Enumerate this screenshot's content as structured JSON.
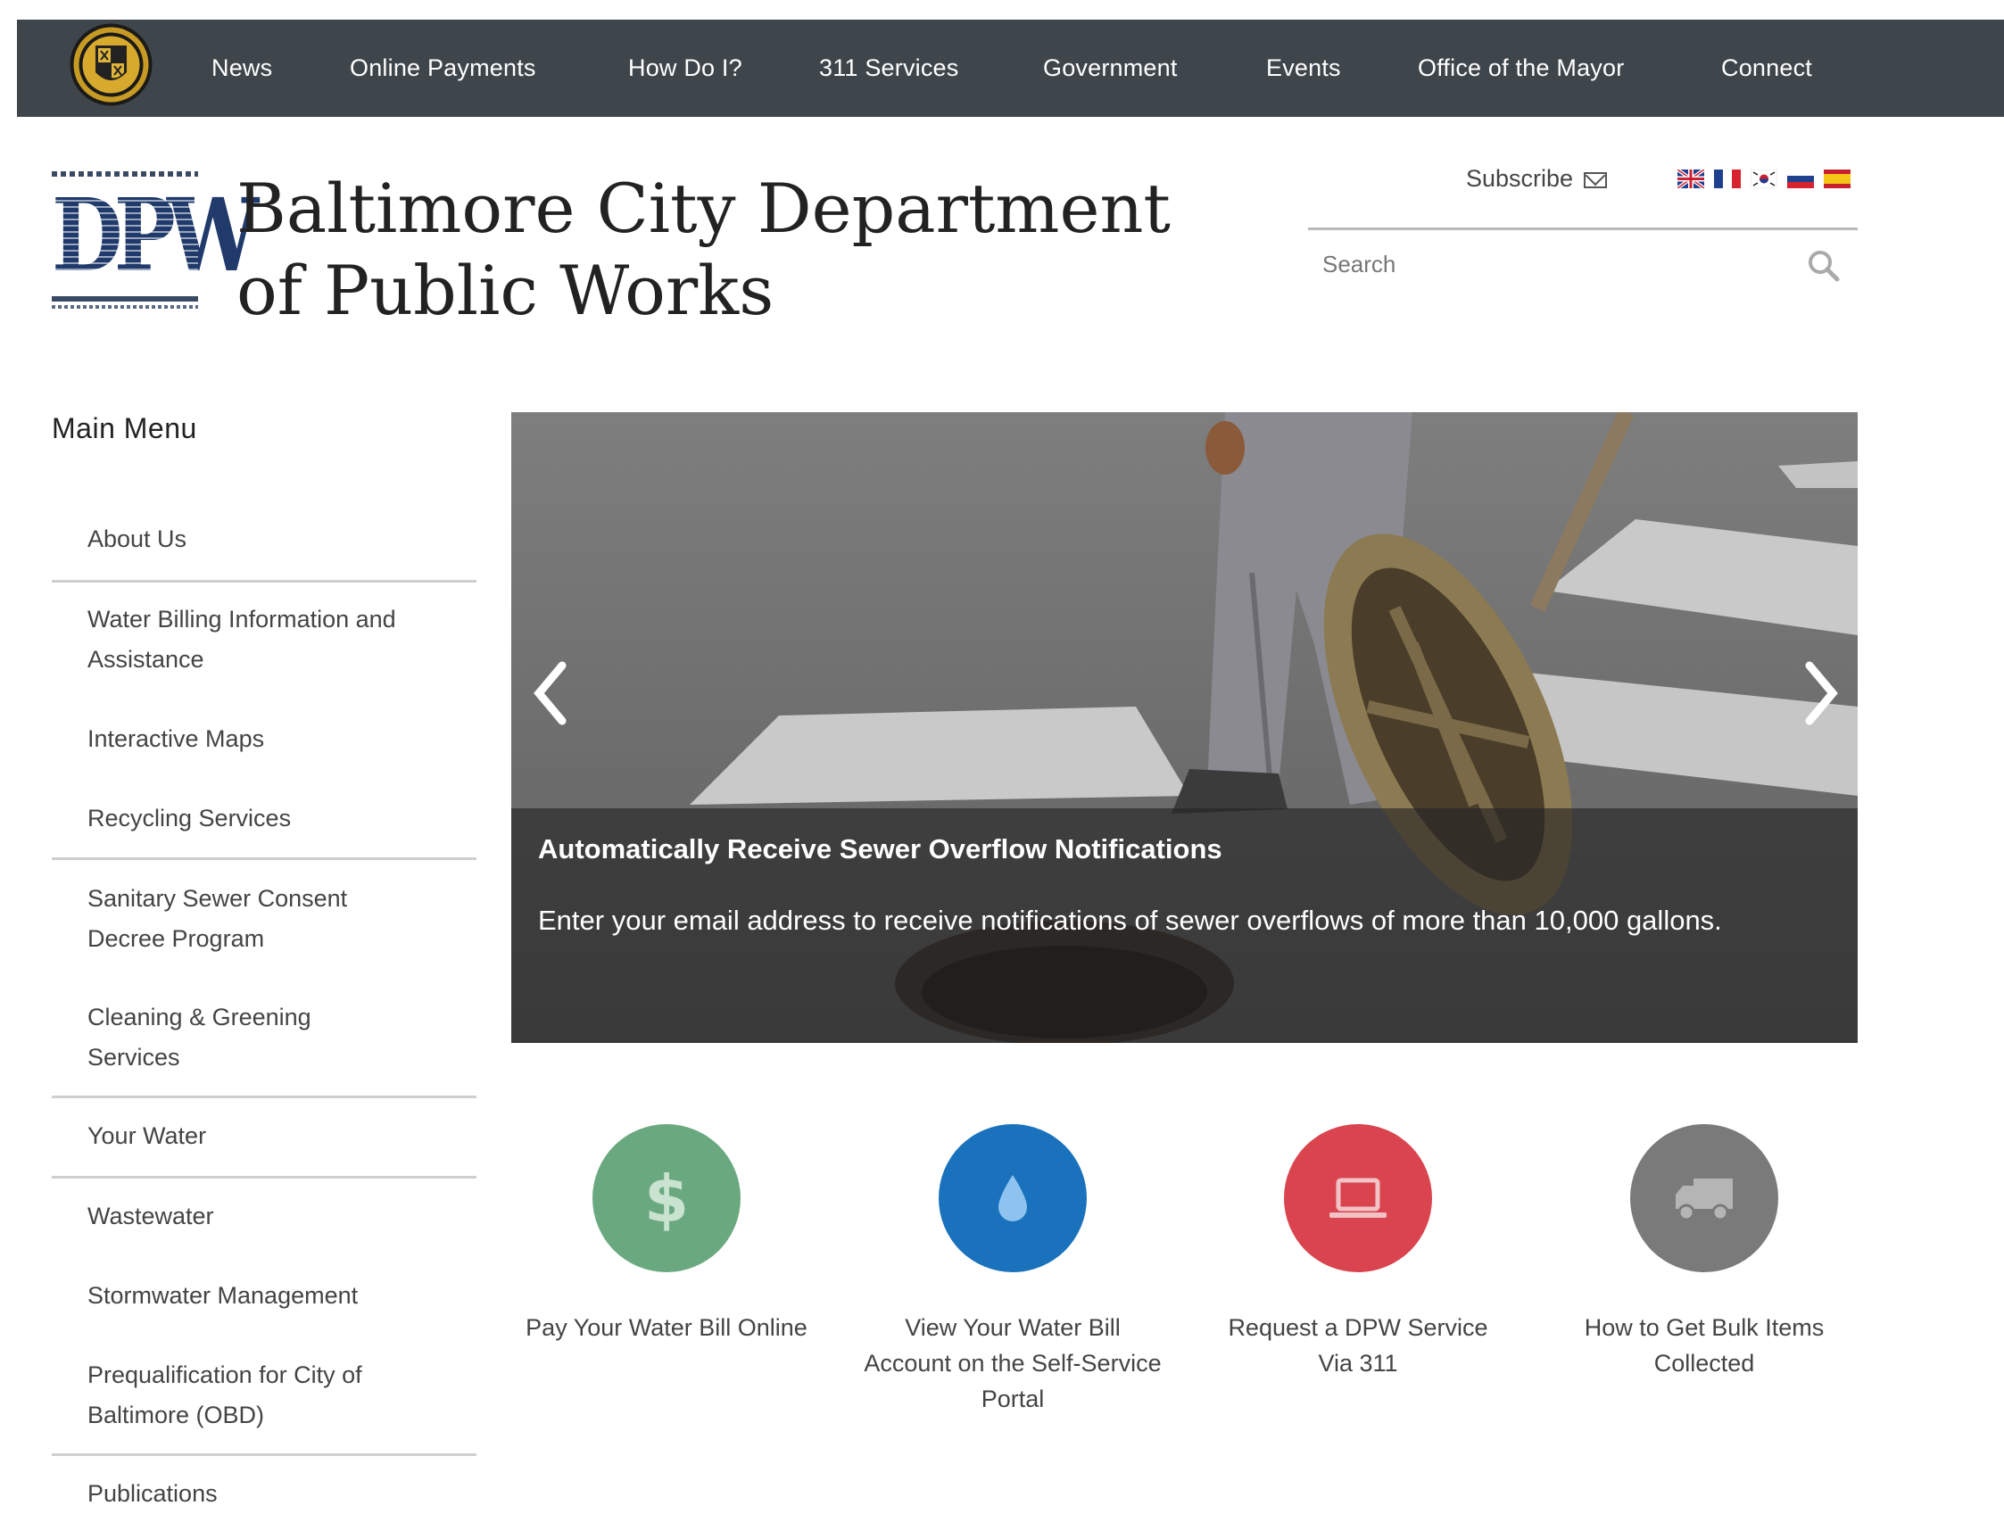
{
  "nav": {
    "items": [
      {
        "label": "News"
      },
      {
        "label": "Online Payments"
      },
      {
        "label": "How Do I?"
      },
      {
        "label": "311 Services"
      },
      {
        "label": "Government"
      },
      {
        "label": "Events"
      },
      {
        "label": "Office of the Mayor"
      },
      {
        "label": "Connect"
      }
    ]
  },
  "header": {
    "title": "Baltimore City Department of Public Works",
    "subscribe_label": "Subscribe",
    "flags": [
      "flag-uk-icon",
      "flag-france-icon",
      "flag-korea-icon",
      "flag-russia-icon",
      "flag-spain-icon"
    ],
    "search_placeholder": "Search"
  },
  "sidebar": {
    "title": "Main Menu",
    "items": [
      {
        "label": "About Us"
      },
      {
        "label": "Water Billing Information and Assistance"
      },
      {
        "label": "Interactive Maps"
      },
      {
        "label": "Recycling Services"
      },
      {
        "label": "Sanitary Sewer Consent Decree Program"
      },
      {
        "label": "Cleaning & Greening Services"
      },
      {
        "label": "Your Water"
      },
      {
        "label": "Wastewater"
      },
      {
        "label": "Stormwater Management"
      },
      {
        "label": "Prequalification for City of Baltimore (OBD)"
      },
      {
        "label": "Publications"
      }
    ]
  },
  "carousel": {
    "title": "Automatically Receive Sewer Overflow Notifications",
    "text": "Enter your email address to receive notifications of sewer overflows of more than 10,000 gallons."
  },
  "tiles": [
    {
      "label": "Pay Your Water Bill Online",
      "icon": "dollar-icon",
      "color": "#6aa97f"
    },
    {
      "label": "View Your Water Bill Account on the Self-Service Portal",
      "icon": "water-drop-icon",
      "color": "#1a72bd"
    },
    {
      "label": "Request a DPW Service Via 311",
      "icon": "laptop-icon",
      "color": "#d9444f"
    },
    {
      "label": "How to Get Bulk Items Collected",
      "icon": "truck-icon",
      "color": "#7a7a7a"
    }
  ]
}
